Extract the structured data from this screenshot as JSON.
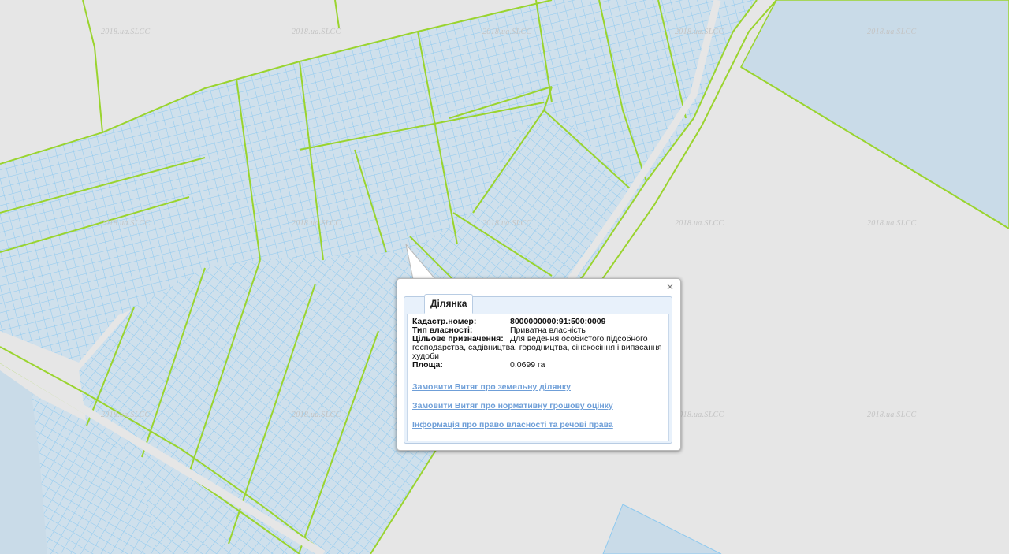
{
  "map": {
    "watermark": "2018.ua.SLCC",
    "colors": {
      "background": "#e6e6e6",
      "water": "#c9dbe8",
      "parcel_fill": "#cfe0ec",
      "parcel_line": "#8ec9ef",
      "block_line": "#9ad42e"
    }
  },
  "popup": {
    "tab_label": "Ділянка",
    "close_icon": "close-icon",
    "fields": {
      "cadastral_label": "Кадастр.номер:",
      "cadastral_value": "8000000000:91:500:0009",
      "ownership_label": "Тип власності:",
      "ownership_value": "Приватна власність",
      "purpose_label": "Цільове призначення:",
      "purpose_value_line1": "Для ведення особистого підсобного",
      "purpose_value_rest": "господарства, садівництва, городництва, сінокосіння і випасання худоби",
      "area_label": "Площа:",
      "area_value": "0.0699 га"
    },
    "links": {
      "extract_land": "Замовити Витяг про земельну ділянку",
      "extract_valuation": "Замовити Витяг про нормативну грошову оцінку",
      "ownership_info": "Інформація про право власності та речові права"
    }
  }
}
